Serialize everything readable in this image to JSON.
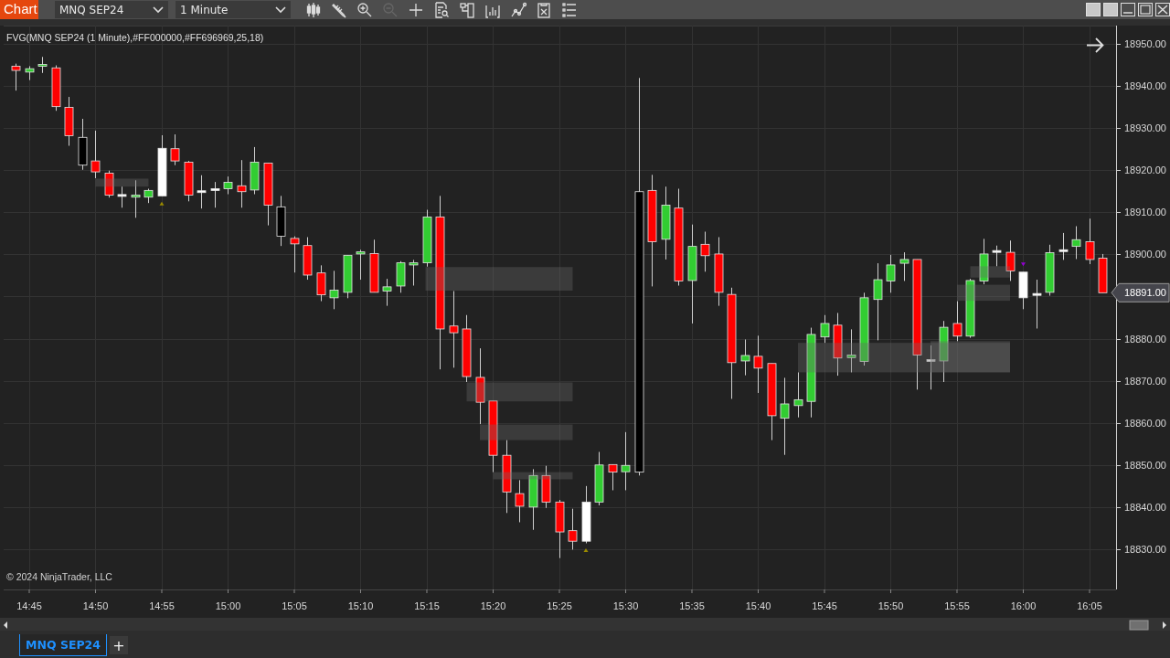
{
  "window": {
    "title": "Chart",
    "instrument": "MNQ SEP24",
    "interval": "1 Minute"
  },
  "toolbar": [
    {
      "kind": "candles",
      "disabled": false
    },
    {
      "kind": "pencil",
      "disabled": false
    },
    {
      "kind": "zoom-in",
      "disabled": false
    },
    {
      "kind": "zoom-out",
      "disabled": true
    },
    {
      "kind": "crosshair",
      "disabled": false
    },
    {
      "kind": "data-box",
      "disabled": false
    },
    {
      "kind": "panel",
      "disabled": false
    },
    {
      "kind": "indicators",
      "disabled": false
    },
    {
      "kind": "strategies",
      "disabled": false
    },
    {
      "kind": "properties",
      "disabled": false
    },
    {
      "kind": "list",
      "disabled": false
    }
  ],
  "window_controls": [
    {
      "kind": "tile"
    },
    {
      "kind": "tile"
    },
    {
      "kind": "minimize"
    },
    {
      "kind": "maximize"
    },
    {
      "kind": "close"
    }
  ],
  "chart": {
    "indicator_label": "FVG(MNQ SEP24 (1 Minute),#FF000000,#FF696969,25,18)",
    "copyright": "© 2024 NinjaTrader, LLC",
    "current_price": "18891.00",
    "chart_data": {
      "type": "candlestick",
      "ylim": [
        18820.44,
        18954.34
      ],
      "categories": [
        null,
        "14:45",
        null,
        null,
        null,
        null,
        "14:50",
        null,
        null,
        null,
        null,
        "14:55",
        null,
        null,
        null,
        null,
        "15:00",
        null,
        null,
        null,
        null,
        "15:05",
        null,
        null,
        null,
        null,
        "15:10",
        null,
        null,
        null,
        null,
        "15:15",
        null,
        null,
        null,
        null,
        "15:20",
        null,
        null,
        null,
        null,
        "15:25",
        null,
        null,
        null,
        null,
        "15:30",
        null,
        null,
        null,
        null,
        "15:35",
        null,
        null,
        null,
        null,
        "15:40",
        null,
        null,
        null,
        null,
        "15:45",
        null,
        null,
        null,
        null,
        "15:50",
        null,
        null,
        null,
        null,
        "15:55",
        null,
        null,
        null,
        null,
        "16:00",
        null,
        null,
        null,
        null,
        "16:05",
        null
      ],
      "yticks": [
        {
          "value": 18950,
          "label": "18950.00"
        },
        {
          "value": 18940,
          "label": "18940.00"
        },
        {
          "value": 18930,
          "label": "18930.00"
        },
        {
          "value": 18920,
          "label": "18920.00"
        },
        {
          "value": 18910,
          "label": "18910.00"
        },
        {
          "value": 18900,
          "label": "18900.00"
        },
        {
          "value": 18880,
          "label": "18880.00"
        },
        {
          "value": 18870,
          "label": "18870.00"
        },
        {
          "value": 18860,
          "label": "18860.00"
        },
        {
          "value": 18850,
          "label": "18850.00"
        },
        {
          "value": 18840,
          "label": "18840.00"
        },
        {
          "value": 18830,
          "label": "18830.00"
        }
      ],
      "ohlc": [
        [
          18944.7,
          18945.3,
          18938.9,
          18943.7
        ],
        [
          18943.3,
          18944.7,
          18941.4,
          18944.1
        ],
        [
          18944.7,
          18946.9,
          18943.1,
          18945.1
        ],
        [
          18944.3,
          18944.9,
          18934.1,
          18935.1
        ],
        [
          18934.9,
          18937.4,
          18925.8,
          18928.2
        ],
        [
          18927.8,
          18932.2,
          18920.1,
          18921.2
        ],
        [
          18922.2,
          18929.4,
          18918.1,
          18919.6
        ],
        [
          18919.3,
          18919.9,
          18913.5,
          18914.1
        ],
        [
          18914.0,
          18916.1,
          18911.1,
          18914.0
        ],
        [
          18913.6,
          18917.6,
          18908.7,
          18914.1
        ],
        [
          18913.6,
          18915.6,
          18912.2,
          18915.2
        ],
        [
          18913.9,
          18928.3,
          18913.9,
          18925.2
        ],
        [
          18925.1,
          18928.5,
          18921.2,
          18922.2
        ],
        [
          18921.9,
          18922.2,
          18912.6,
          18914.1
        ],
        [
          18914.9,
          18918.8,
          18910.9,
          18914.9
        ],
        [
          18915.4,
          18917.2,
          18911.1,
          18915.4
        ],
        [
          18915.6,
          18918.5,
          18914.3,
          18917.1
        ],
        [
          18916.3,
          18922.4,
          18911.1,
          18914.9
        ],
        [
          18915.3,
          18925.5,
          18914.3,
          18921.9
        ],
        [
          18921.7,
          18921.7,
          18906.9,
          18911.7
        ],
        [
          18911.3,
          18913.9,
          18902.0,
          18904.3
        ],
        [
          18903.8,
          18904.3,
          18895.7,
          18902.5
        ],
        [
          18902.1,
          18904.1,
          18894.0,
          18895.1
        ],
        [
          18895.6,
          18897.4,
          18888.9,
          18890.4
        ],
        [
          18889.7,
          18896.1,
          18887.0,
          18891.5
        ],
        [
          18891.0,
          18899.8,
          18889.6,
          18899.8
        ],
        [
          18900.1,
          18901.1,
          18894.0,
          18900.6
        ],
        [
          18900.2,
          18903.5,
          18891.0,
          18891.0
        ],
        [
          18891.3,
          18894.2,
          18887.8,
          18892.3
        ],
        [
          18892.5,
          18898.4,
          18890.9,
          18898.0
        ],
        [
          18897.5,
          18898.7,
          18892.6,
          18898.0
        ],
        [
          18898.0,
          18910.6,
          18897.1,
          18908.9
        ],
        [
          18908.9,
          18913.9,
          18872.7,
          18882.3
        ],
        [
          18883.0,
          18891.3,
          18873.1,
          18881.4
        ],
        [
          18882.3,
          18885.6,
          18869.7,
          18871.0
        ],
        [
          18870.8,
          18877.7,
          18859.7,
          18864.9
        ],
        [
          18865.2,
          18865.2,
          18848.3,
          18852.3
        ],
        [
          18852.3,
          18855.9,
          18838.6,
          18843.6
        ],
        [
          18843.2,
          18846.4,
          18836.4,
          18840.2
        ],
        [
          18840.0,
          18849.0,
          18834.6,
          18847.5
        ],
        [
          18847.5,
          18849.8,
          18839.8,
          18841.2
        ],
        [
          18841.2,
          18841.7,
          18827.9,
          18834.1
        ],
        [
          18834.4,
          18839.6,
          18829.9,
          18831.9
        ],
        [
          18831.9,
          18845.0,
          18831.4,
          18841.2
        ],
        [
          18841.2,
          18853.1,
          18840.4,
          18850.0
        ],
        [
          18850.1,
          18850.1,
          18844.0,
          18848.3
        ],
        [
          18848.4,
          18857.8,
          18844.0,
          18849.9
        ],
        [
          18848.3,
          18941.9,
          18847.5,
          18914.9
        ],
        [
          18915.2,
          18918.9,
          18892.4,
          18903.0
        ],
        [
          18903.6,
          18916.1,
          18898.8,
          18911.7
        ],
        [
          18911.0,
          18915.6,
          18892.6,
          18893.7
        ],
        [
          18893.8,
          18907.1,
          18883.6,
          18901.9
        ],
        [
          18902.4,
          18905.4,
          18895.9,
          18899.7
        ],
        [
          18900.1,
          18904.1,
          18887.8,
          18891.0
        ],
        [
          18890.5,
          18892.1,
          18865.7,
          18874.3
        ],
        [
          18874.7,
          18879.8,
          18871.3,
          18876.0
        ],
        [
          18875.8,
          18880.7,
          18867.1,
          18873.0
        ],
        [
          18874.1,
          18874.1,
          18855.9,
          18861.7
        ],
        [
          18861.1,
          18870.7,
          18852.4,
          18864.5
        ],
        [
          18864.1,
          18872.0,
          18861.3,
          18865.5
        ],
        [
          18865.1,
          18882.6,
          18861.3,
          18881.0
        ],
        [
          18880.4,
          18885.6,
          18879.0,
          18883.6
        ],
        [
          18883.2,
          18886.1,
          18871.2,
          18875.4
        ],
        [
          18875.5,
          18882.2,
          18872.0,
          18876.1
        ],
        [
          18874.6,
          18890.9,
          18873.6,
          18889.7
        ],
        [
          18889.3,
          18897.9,
          18879.6,
          18894.0
        ],
        [
          18893.7,
          18899.9,
          18890.9,
          18897.5
        ],
        [
          18897.9,
          18900.5,
          18893.7,
          18898.8
        ],
        [
          18898.8,
          18898.8,
          18867.9,
          18876.1
        ],
        [
          18874.8,
          18878.4,
          18867.9,
          18874.8
        ],
        [
          18874.7,
          18884.2,
          18869.7,
          18882.7
        ],
        [
          18883.6,
          18888.9,
          18879.4,
          18880.6
        ],
        [
          18880.6,
          18894.2,
          18880.2,
          18893.8
        ],
        [
          18893.7,
          18903.7,
          18892.9,
          18900.1
        ],
        [
          18900.7,
          18902.1,
          18897.2,
          18900.7
        ],
        [
          18900.5,
          18903.3,
          18893.7,
          18896.1
        ],
        [
          18895.8,
          18895.8,
          18887.0,
          18889.7
        ],
        [
          18890.5,
          18894.0,
          18882.4,
          18890.5
        ],
        [
          18891.0,
          18902.3,
          18890.2,
          18900.4
        ],
        [
          18900.9,
          18905.1,
          18898.7,
          18900.9
        ],
        [
          18901.9,
          18906.7,
          18898.9,
          18903.5
        ],
        [
          18903.0,
          18908.5,
          18897.7,
          18898.8
        ],
        [
          18899.1,
          18900.1,
          18890.9,
          18890.9
        ]
      ],
      "colors": [
        "#ff0000",
        "#32cd32",
        "#32cd32",
        "#ff0000",
        "#ff0000",
        "#000000",
        "#ff0000",
        "#ff0000",
        "#ffffff",
        "#32cd32",
        "#32cd32",
        "#ffffff",
        "#ff0000",
        "#ff0000",
        "#ffffff",
        "#ffffff",
        "#32cd32",
        "#ff0000",
        "#32cd32",
        "#ff0000",
        "#000000",
        "#ff0000",
        "#ff0000",
        "#ff0000",
        "#32cd32",
        "#32cd32",
        "#32cd32",
        "#ff0000",
        "#32cd32",
        "#32cd32",
        "#32cd32",
        "#32cd32",
        "#ff0000",
        "#ff0000",
        "#ff0000",
        "#ff0000",
        "#ff0000",
        "#ff0000",
        "#ff0000",
        "#32cd32",
        "#ff0000",
        "#ff0000",
        "#ff0000",
        "#ffffff",
        "#32cd32",
        "#ff0000",
        "#32cd32",
        "#000000",
        "#ff0000",
        "#32cd32",
        "#ff0000",
        "#32cd32",
        "#ff0000",
        "#ff0000",
        "#ff0000",
        "#32cd32",
        "#ff0000",
        "#ff0000",
        "#32cd32",
        "#32cd32",
        "#32cd32",
        "#32cd32",
        "#ff0000",
        "#32cd32",
        "#32cd32",
        "#32cd32",
        "#32cd32",
        "#32cd32",
        "#ff0000",
        "#ffffff",
        "#32cd32",
        "#ff0000",
        "#32cd32",
        "#32cd32",
        "#ffffff",
        "#ff0000",
        "#ffffff",
        "#ffffff",
        "#32cd32",
        "#ffffff",
        "#32cd32",
        "#ff0000",
        "#ff0000"
      ],
      "grid": true
    }
  },
  "tabs": [
    {
      "label": "MNQ SEP24",
      "selected": true
    }
  ],
  "new_tab": "+"
}
